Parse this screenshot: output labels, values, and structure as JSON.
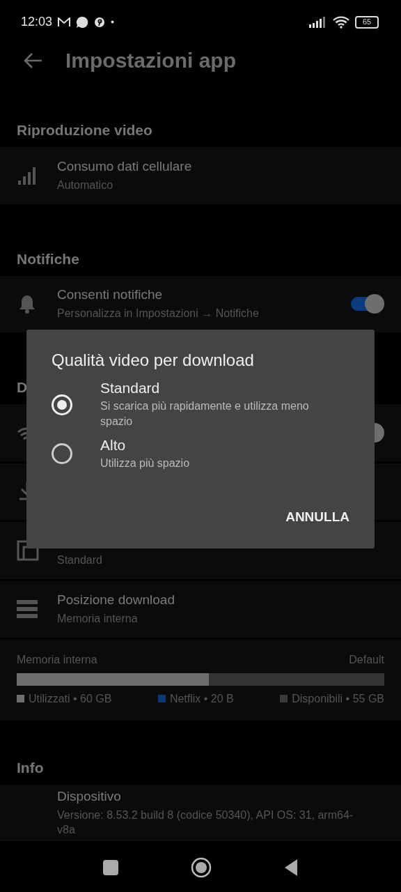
{
  "status_bar": {
    "time": "12:03",
    "battery": "65"
  },
  "header": {
    "title": "Impostazioni app"
  },
  "sections": [
    {
      "title": "Riproduzione video",
      "rows": [
        {
          "kind": "plain",
          "title": "Consumo dati cellulare",
          "subtitle": "Automatico"
        }
      ]
    },
    {
      "title": "Notifiche",
      "rows": [
        {
          "kind": "toggle",
          "title": "Consenti notifiche",
          "subtitle": "Personalizza in Impostazioni → Notifiche",
          "on": true
        }
      ]
    },
    {
      "title": "D",
      "rows": [
        {
          "kind": "toggle",
          "on": true
        },
        {
          "kind": "plain"
        },
        {
          "kind": "plain",
          "subtitle": "Standard"
        },
        {
          "kind": "plain",
          "title": "Posizione download",
          "subtitle": "Memoria interna"
        },
        {
          "kind": "storage",
          "label": "Memoria interna",
          "tag": "Default",
          "level": 0.523,
          "legend": [
            {
              "text": "Utilizzati • 60 GB",
              "color": "#6e6e6e"
            },
            {
              "text": "Netflix • 20 B",
              "color": "#0a3a7a"
            },
            {
              "text": "Disponibili • 55 GB",
              "color": "#3a3a3a"
            }
          ]
        }
      ]
    },
    {
      "title": "Info",
      "rows": [
        {
          "kind": "plain",
          "title": "Dispositivo",
          "subtitle": "Versione: 8.53.2 build 8 (codice 50340), API OS: 31, arm64-v8a"
        }
      ]
    }
  ],
  "dialog": {
    "title": "Qualità video per download",
    "options": [
      {
        "label": "Standard",
        "description": "Si scarica più rapidamente e utilizza meno spazio",
        "selected": true
      },
      {
        "label": "Alto",
        "description": "Utilizza più spazio",
        "selected": false
      }
    ],
    "button": "ANNULLA"
  }
}
